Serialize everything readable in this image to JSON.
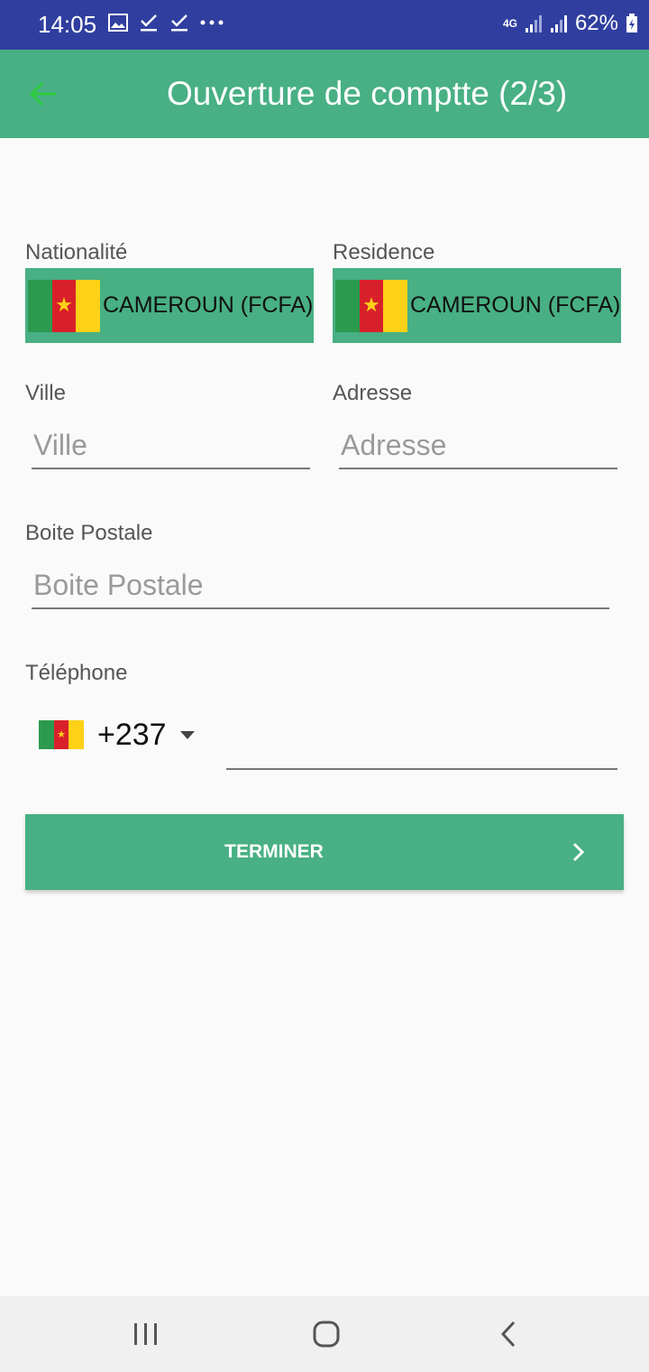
{
  "status_bar": {
    "time": "14:05",
    "network": "4G",
    "battery": "62%"
  },
  "app_bar": {
    "title": "Ouverture de comptte (2/3)",
    "back_icon": "arrow-left-icon"
  },
  "form": {
    "nationality": {
      "label": "Nationalité",
      "value": "CAMEROUN (FCFA)",
      "flag": "cameroon-flag-icon"
    },
    "residence": {
      "label": "Residence",
      "value": "CAMEROUN (FCFA)",
      "flag": "cameroon-flag-icon"
    },
    "city": {
      "label": "Ville",
      "placeholder": "Ville"
    },
    "address": {
      "label": "Adresse",
      "placeholder": "Adresse"
    },
    "po_box": {
      "label": "Boite Postale",
      "placeholder": "Boite Postale"
    },
    "phone": {
      "label": "Téléphone",
      "country_code": "+237",
      "value": ""
    },
    "submit_label": "TERMINER"
  },
  "colors": {
    "status_bar": "#303f9f",
    "primary": "#48b084",
    "back_arrow": "#2ecc40",
    "cameroon_green": "#2c9a4e",
    "cameroon_red": "#d8202a",
    "cameroon_yellow": "#fcd116"
  }
}
